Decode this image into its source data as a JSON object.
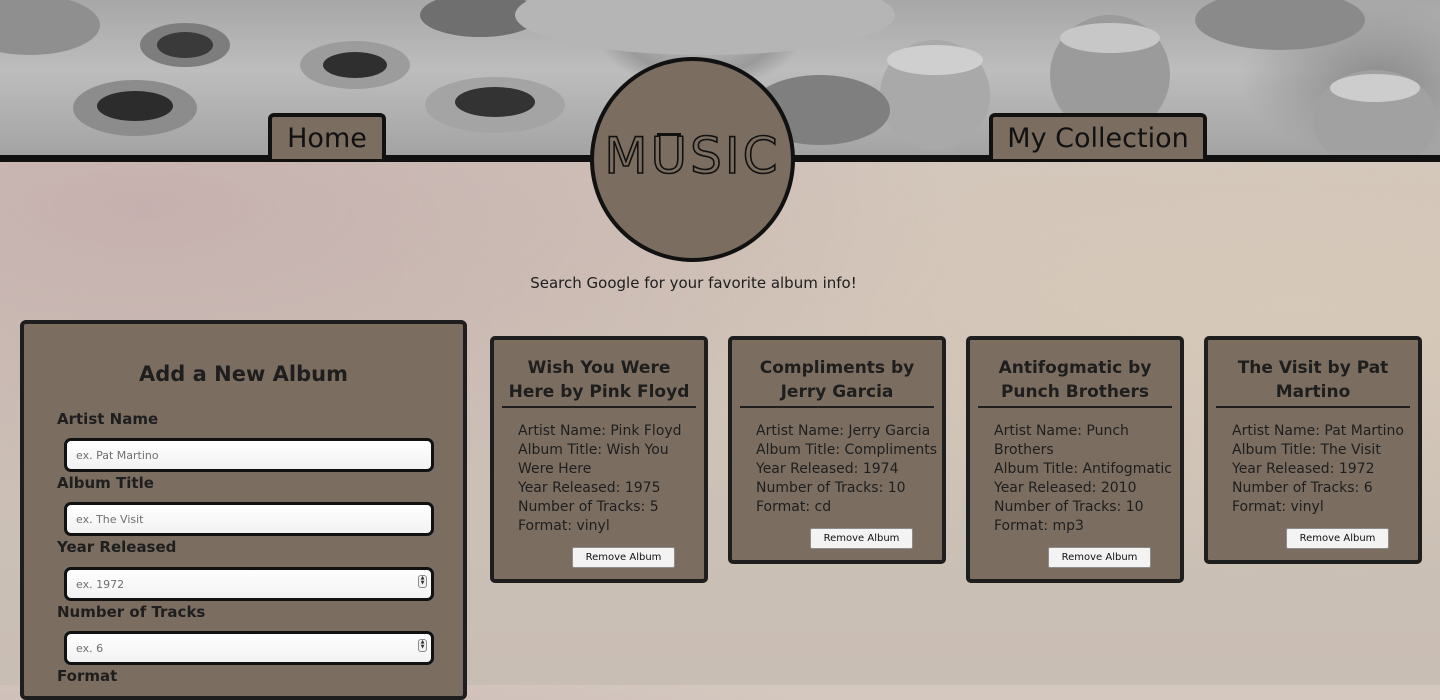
{
  "nav": {
    "home_label": "Home",
    "collection_label": "My Collection",
    "logo_text": "MUSIC"
  },
  "tagline": "Search Google for your favorite album info!",
  "form": {
    "title": "Add a New Album",
    "artist_label": "Artist Name",
    "artist_placeholder": "ex. Pat Martino",
    "album_label": "Album Title",
    "album_placeholder": "ex. The Visit",
    "year_label": "Year Released",
    "year_placeholder": "ex. 1972",
    "tracks_label": "Number of Tracks",
    "tracks_placeholder": "ex. 6",
    "format_label": "Format"
  },
  "albums": [
    {
      "title": "Wish You Were Here by Pink Floyd",
      "artist": "Artist Name: Pink Floyd",
      "album": "Album Title: Wish You Were Here",
      "year": "Year Released: 1975",
      "tracks": "Number of Tracks: 5",
      "format": "Format: vinyl",
      "remove_label": "Remove Album"
    },
    {
      "title": "Compliments by Jerry Garcia",
      "artist": "Artist Name: Jerry Garcia",
      "album": "Album Title: Compliments",
      "year": "Year Released: 1974",
      "tracks": "Number of Tracks: 10",
      "format": "Format: cd",
      "remove_label": "Remove Album"
    },
    {
      "title": "Antifogmatic by Punch Brothers",
      "artist": "Artist Name: Punch Brothers",
      "album": "Album Title: Antifogmatic",
      "year": "Year Released: 2010",
      "tracks": "Number of Tracks: 10",
      "format": "Format: mp3",
      "remove_label": "Remove Album"
    },
    {
      "title": "The Visit by Pat Martino",
      "artist": "Artist Name: Pat Martino",
      "album": "Album Title: The Visit",
      "year": "Year Released: 1972",
      "tracks": "Number of Tracks: 6",
      "format": "Format: vinyl",
      "remove_label": "Remove Album"
    }
  ],
  "colors": {
    "panel": "#7b6e61",
    "border": "#1e1e1e",
    "text": "#1e1e1e"
  }
}
